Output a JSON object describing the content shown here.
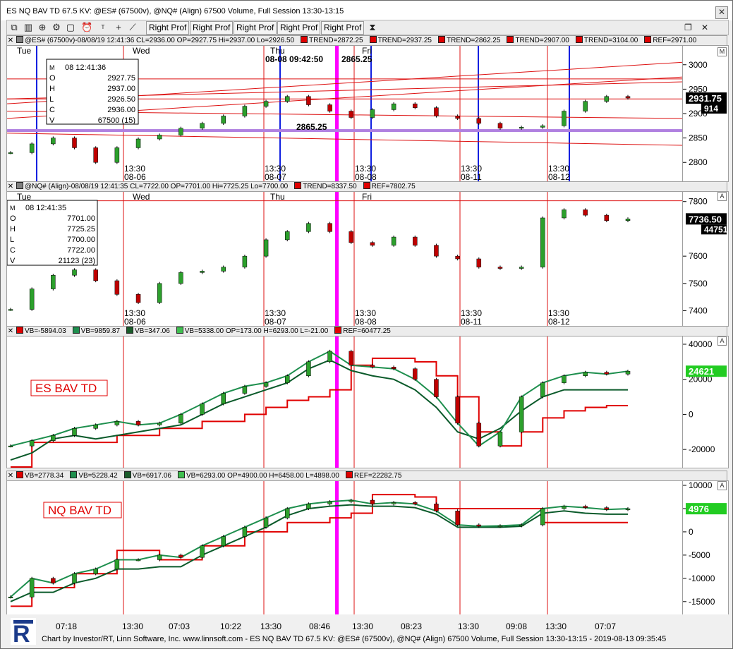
{
  "window": {
    "title": "ES NQ BAV TD 67.5 KV: @ES# (67500v), @NQ# (Align) 67500 Volume, Full Session 13:30-13:15",
    "close_icon": "close-icon"
  },
  "toolbar": {
    "buttons": [
      "Right Prof",
      "Right Prof",
      "Right Prof",
      "Right Prof",
      "Right Prof"
    ],
    "icons": [
      "copy-icon",
      "bar-chart-icon",
      "zoom-icon",
      "gear-icon",
      "alarm-icon",
      "title-icon",
      "crosshair-icon",
      "line-tool-icon",
      "hourglass-icon",
      "restore-icon",
      "close-icon"
    ]
  },
  "panes": {
    "es": {
      "header": [
        "@ES# (67500v)-08/08/19 12:41:36 CL=2936.00 OP=2927.75 Hi=2937.00 Lo=2926.50",
        "TREND=2872.25",
        "TREND=2937.25",
        "TREND=2862.25",
        "TREND=2907.00",
        "TREND=3104.00",
        "REF=2971.00"
      ],
      "header_colors": [
        "#808080",
        "#e00000",
        "#e00000",
        "#e00000",
        "#e00000",
        "#e00000",
        "#e00000"
      ],
      "day_labels": [
        "Tue",
        "Wed",
        "Thu",
        "Fri"
      ],
      "cursor_time": "08-08 09:42:50",
      "cursor_price": "2865.25",
      "mid_label": "2865.25",
      "session_labels": [
        {
          "time": "13:30",
          "date": "08-06"
        },
        {
          "time": "13:30",
          "date": "08-07"
        },
        {
          "time": "13:30",
          "date": "08-08"
        },
        {
          "time": "13:30",
          "date": "08-11"
        },
        {
          "time": "13:30",
          "date": "08-12"
        }
      ],
      "data_box": {
        "title": "08 12:41:36",
        "rows": [
          [
            "O",
            "2927.75"
          ],
          [
            "H",
            "2937.00"
          ],
          [
            "L",
            "2926.50"
          ],
          [
            "C",
            "2936.00"
          ],
          [
            "V",
            "67500 (15)"
          ]
        ]
      },
      "y_ticks": [
        "3000",
        "2950",
        "2900",
        "2850",
        "2800"
      ],
      "last_price": "2931.75",
      "last_volume": "914",
      "scale_btn": "M"
    },
    "nq": {
      "header": [
        "@NQ# (Align)-08/08/19 12:41:35 CL=7722.00 OP=7701.00 Hi=7725.25 Lo=7700.00",
        "TREND=8337.50",
        "REF=7802.75"
      ],
      "header_colors": [
        "#808080",
        "#e00000",
        "#e00000"
      ],
      "day_labels": [
        "Tue",
        "Wed",
        "Thu",
        "Fri"
      ],
      "session_labels": [
        {
          "time": "13:30",
          "date": "08-06"
        },
        {
          "time": "13:30",
          "date": "08-07"
        },
        {
          "time": "13:30",
          "date": "08-08"
        },
        {
          "time": "13:30",
          "date": "08-11"
        },
        {
          "time": "13:30",
          "date": "08-12"
        }
      ],
      "data_box": {
        "title": "08 12:41:35",
        "rows": [
          [
            "O",
            "7701.00"
          ],
          [
            "H",
            "7725.25"
          ],
          [
            "L",
            "7700.00"
          ],
          [
            "C",
            "7722.00"
          ],
          [
            "V",
            "21123 (23)"
          ]
        ]
      },
      "y_ticks": [
        "7800",
        "7600",
        "7500",
        "7400"
      ],
      "last_price": "7736.50",
      "last_volume": "44751",
      "scale_btn": "A"
    },
    "es_bav": {
      "header": [
        "VB=-5894.03",
        "VB=9859.87",
        "VB=347.06",
        "VB=5338.00 OP=173.00 H=6293.00 L=-21.00",
        "REF=60477.25"
      ],
      "header_colors": [
        "#e00000",
        "#1e8f4e",
        "#1a5c2a",
        "#3fbf4f",
        "#e00000"
      ],
      "label": "ES BAV TD",
      "y_ticks": [
        "40000",
        "20000",
        "0",
        "-20000"
      ],
      "last_value": "24621",
      "scale_btn": "A"
    },
    "nq_bav": {
      "header": [
        "VB=2778.34",
        "VB=5228.42",
        "VB=6917.06",
        "VB=6293.00 OP=4900.00 H=6458.00 L=4898.00",
        "REF=22282.75"
      ],
      "header_colors": [
        "#e00000",
        "#1e8f4e",
        "#1a5c2a",
        "#3fbf4f",
        "#e00000"
      ],
      "label": "NQ BAV TD",
      "y_ticks": [
        "10000",
        "5000",
        "0",
        "-5000",
        "-10000",
        "-15000"
      ],
      "last_value": "4976",
      "scale_btn": "A"
    }
  },
  "x_axis": {
    "labels": [
      "07:18",
      "13:30",
      "07:03",
      "10:22",
      "13:30",
      "08:46",
      "13:30",
      "08:23",
      "13:30",
      "09:08",
      "13:30",
      "07:07"
    ]
  },
  "footer": {
    "text": "Chart by Investor/RT, Linn Software, Inc. www.linnsoft.com - ES NQ BAV TD 67.5 KV: @ES# (67500v), @NQ# (Align) 67500 Volume, Full Session 13:30-13:15 - 2019-08-13 09:35:45"
  },
  "chart_data": [
    {
      "type": "candlestick",
      "title": "@ES# (67500v)",
      "session_dates": [
        "08-06",
        "08-07",
        "08-08",
        "08-11",
        "08-12"
      ],
      "close_approx": [
        2820,
        2838,
        2850,
        2830,
        2800,
        2830,
        2848,
        2856,
        2870,
        2880,
        2895,
        2915,
        2925,
        2935,
        2918,
        2905,
        2892,
        2908,
        2920,
        2912,
        2895,
        2890,
        2880,
        2870,
        2872,
        2875,
        2905,
        2925,
        2935,
        2931.75
      ],
      "ylim": [
        2770,
        3030
      ],
      "last_bar": {
        "open": 2927.75,
        "high": 2937.0,
        "low": 2926.5,
        "close": 2936.0,
        "volume": 67500
      },
      "trend_lines": [
        2872.25,
        2937.25,
        2862.25,
        2907.0,
        3104.0
      ],
      "ref": 2971.0
    },
    {
      "type": "candlestick",
      "title": "@NQ# (Align)",
      "session_dates": [
        "08-06",
        "08-07",
        "08-08",
        "08-11",
        "08-12"
      ],
      "close_approx": [
        7405,
        7480,
        7530,
        7550,
        7510,
        7460,
        7430,
        7500,
        7540,
        7545,
        7560,
        7600,
        7660,
        7690,
        7720,
        7690,
        7650,
        7640,
        7670,
        7640,
        7600,
        7590,
        7560,
        7555,
        7560,
        7740,
        7770,
        7750,
        7730,
        7736.5
      ],
      "ylim": [
        7360,
        7820
      ],
      "last_bar": {
        "open": 7701.0,
        "high": 7725.25,
        "low": 7700.0,
        "close": 7722.0,
        "volume": 21123
      },
      "trend_lines": [
        8337.5
      ],
      "ref": 7802.75
    },
    {
      "type": "line",
      "title": "ES BAV TD",
      "series": [
        {
          "values": [
            -18000,
            -15000,
            -12000,
            -8000,
            -6000,
            -4000,
            -6000,
            -5000,
            0,
            6000,
            12000,
            16000,
            18000,
            22000,
            30000,
            36000,
            28000,
            27000,
            26000,
            20000,
            10000,
            -5000,
            -18000,
            -10000,
            10000,
            18000,
            22000,
            24000,
            23000,
            24621
          ]
        },
        {
          "values": [
            -26000,
            -22000,
            -14000,
            -12000,
            -14000,
            -12000,
            -10000,
            -8000,
            -6000,
            0,
            6000,
            10000,
            14000,
            18000,
            26000,
            31000,
            25000,
            22000,
            20000,
            14000,
            4000,
            -10000,
            -14000,
            -8000,
            2000,
            10000,
            14000,
            14000,
            14000,
            14000
          ]
        },
        {
          "values": [
            -30000,
            -16000,
            -16000,
            -16000,
            -16000,
            -12000,
            -12000,
            -8000,
            -8000,
            -4000,
            -4000,
            0,
            4000,
            8000,
            10000,
            14000,
            28000,
            32000,
            32000,
            30000,
            22000,
            10000,
            -10000,
            -18000,
            -10000,
            -2000,
            2000,
            4000,
            5000,
            5000
          ]
        }
      ],
      "ylim": [
        -28000,
        42000
      ],
      "last_value": 24621
    },
    {
      "type": "line",
      "title": "NQ BAV TD",
      "series": [
        {
          "values": [
            -14000,
            -10000,
            -11000,
            -9000,
            -8000,
            -6000,
            -6000,
            -5000,
            -5500,
            -3000,
            -1000,
            1000,
            3000,
            5000,
            6000,
            6500,
            6800,
            6000,
            6300,
            6000,
            4500,
            1500,
            1200,
            1300,
            1500,
            5000,
            5500,
            5200,
            4800,
            4976
          ]
        },
        {
          "values": [
            -15000,
            -13000,
            -13000,
            -11000,
            -10000,
            -8000,
            -8000,
            -7500,
            -7500,
            -5000,
            -3000,
            -1000,
            1000,
            3500,
            5000,
            5500,
            5800,
            5500,
            5500,
            5200,
            3800,
            1000,
            1000,
            1000,
            1200,
            4000,
            4500,
            4000,
            3800,
            3800
          ]
        },
        {
          "values": [
            -16000,
            -12000,
            -12000,
            -9000,
            -9000,
            -4000,
            -4000,
            -6000,
            -6000,
            -3000,
            -3000,
            0,
            0,
            2000,
            2000,
            3000,
            4000,
            8000,
            8000,
            7500,
            5000,
            5000,
            5000,
            5000,
            5000,
            2000,
            2000,
            2000,
            2000,
            2000
          ]
        }
      ],
      "ylim": [
        -17000,
        10000
      ],
      "last_value": 4976
    }
  ]
}
